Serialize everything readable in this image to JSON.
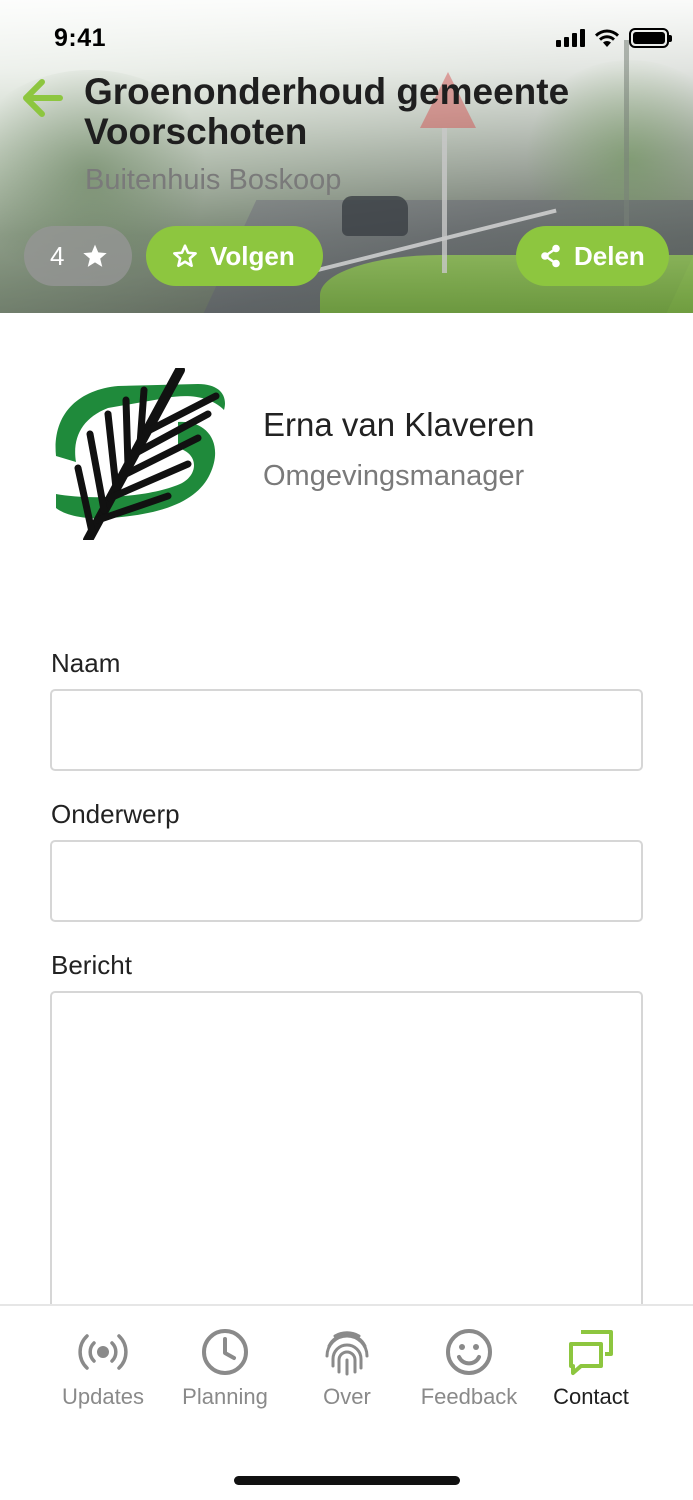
{
  "status_bar": {
    "time": "9:41"
  },
  "header": {
    "title": "Groenonderhoud gemeente Voorschoten",
    "subtitle": "Buitenhuis Boskoop",
    "rating_count": "4",
    "follow_label": "Volgen",
    "share_label": "Delen",
    "accent_color": "#8dc63f"
  },
  "contact": {
    "name": "Erna van Klaveren",
    "role": "Omgevingsmanager"
  },
  "form": {
    "name_label": "Naam",
    "name_value": "",
    "subject_label": "Onderwerp",
    "subject_value": "",
    "message_label": "Bericht",
    "message_value": ""
  },
  "tabbar": {
    "tabs": [
      {
        "label": "Updates",
        "icon": "broadcast-icon"
      },
      {
        "label": "Planning",
        "icon": "clock-icon"
      },
      {
        "label": "Over",
        "icon": "fingerprint-icon"
      },
      {
        "label": "Feedback",
        "icon": "smiley-icon"
      },
      {
        "label": "Contact",
        "icon": "chat-bubbles-icon",
        "active": true
      }
    ]
  }
}
